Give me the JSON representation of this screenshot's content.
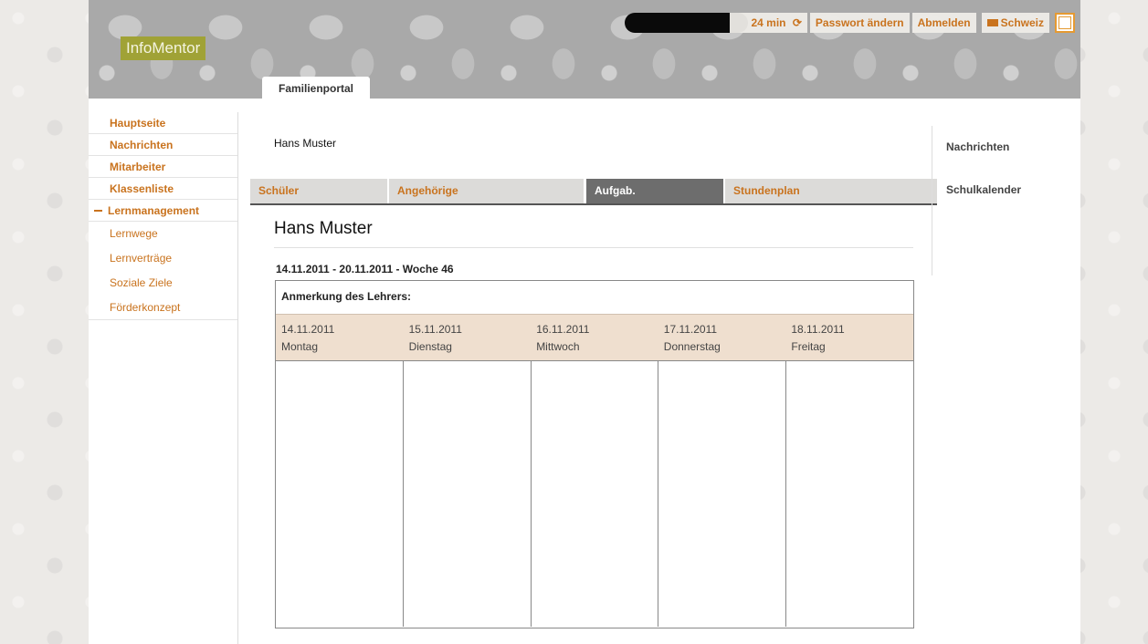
{
  "header": {
    "logo": "InfoMentor",
    "portal_tab": "Familienportal",
    "session_time": "24 min",
    "change_password": "Passwort ändern",
    "logout": "Abmelden",
    "country": "Schweiz"
  },
  "sidebar": {
    "items": [
      {
        "label": "Hauptseite"
      },
      {
        "label": "Nachrichten"
      },
      {
        "label": "Mitarbeiter"
      },
      {
        "label": "Klassenliste"
      },
      {
        "label": "Lernmanagement"
      },
      {
        "label": "Lernwege"
      },
      {
        "label": "Lernverträge"
      },
      {
        "label": "Soziale Ziele"
      },
      {
        "label": "Förderkonzept"
      }
    ]
  },
  "main": {
    "user_name": "Hans Muster",
    "tabs": [
      {
        "label": "Schüler"
      },
      {
        "label": "Angehörige"
      },
      {
        "label": "Aufgab."
      },
      {
        "label": "Stundenplan"
      }
    ],
    "student_name": "Hans Muster",
    "week_title": "14.11.2011 - 20.11.2011 - Woche 46",
    "teacher_note": "Anmerkung des Lehrers:",
    "days": [
      {
        "date": "14.11.2011",
        "day": "Montag"
      },
      {
        "date": "15.11.2011",
        "day": "Dienstag"
      },
      {
        "date": "16.11.2011",
        "day": "Mittwoch"
      },
      {
        "date": "17.11.2011",
        "day": "Donnerstag"
      },
      {
        "date": "18.11.2011",
        "day": "Freitag"
      }
    ]
  },
  "right_panel": {
    "items": [
      {
        "label": "Nachrichten"
      },
      {
        "label": "Schulkalender"
      }
    ]
  },
  "colors": {
    "accent": "#c9731e",
    "logo_bg": "#a0a236",
    "day_header_bg": "#efdfcf"
  }
}
